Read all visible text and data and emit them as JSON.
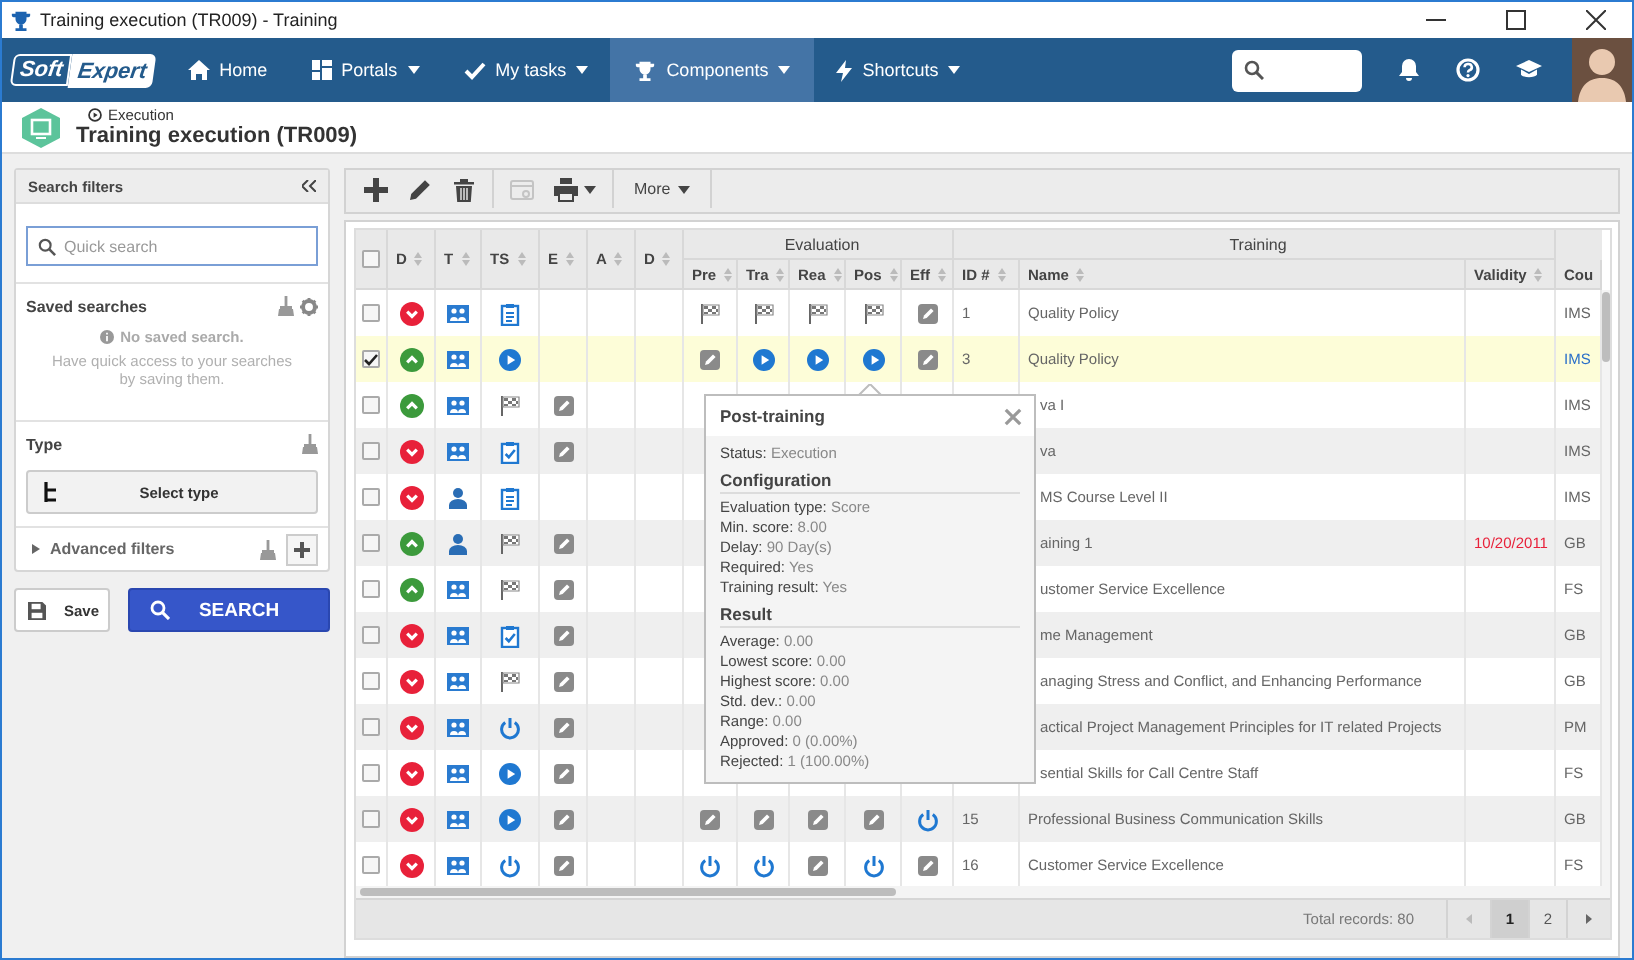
{
  "window": {
    "title": "Training execution (TR009) - Training"
  },
  "nav": {
    "logo_left": "Soft",
    "logo_right": "Expert",
    "items": [
      {
        "label": "Home",
        "dropdown": false,
        "selected": false
      },
      {
        "label": "Portals",
        "dropdown": true,
        "selected": false
      },
      {
        "label": "My tasks",
        "dropdown": true,
        "selected": false
      },
      {
        "label": "Components",
        "dropdown": true,
        "selected": true
      },
      {
        "label": "Shortcuts",
        "dropdown": true,
        "selected": false
      }
    ]
  },
  "page": {
    "breadcrumb": "Execution",
    "title": "Training execution (TR009)"
  },
  "filters": {
    "title": "Search filters",
    "quick_search": {
      "placeholder": "Quick search"
    },
    "saved": {
      "title": "Saved searches",
      "empty": "No saved search.",
      "hint": "Have quick access to your searches by saving them."
    },
    "type": {
      "title": "Type",
      "button": "Select type"
    },
    "advanced": {
      "title": "Advanced filters",
      "expanded": false
    },
    "save_button": "Save",
    "search_button": "SEARCH"
  },
  "toolbar": {
    "buttons": [
      {
        "disabled": false
      },
      {
        "disabled": false
      },
      {
        "disabled": false
      },
      {
        "disabled": true
      },
      {
        "disabled": false
      }
    ],
    "more": "More"
  },
  "grid": {
    "all_checked": false,
    "groups": [
      "Evaluation",
      "Training"
    ],
    "columns": [
      "D",
      "T",
      "TS",
      "E",
      "A",
      "D",
      "Pre",
      "Tra",
      "Rea",
      "Pos",
      "Eff",
      "ID #",
      "Name",
      "Validity",
      "Cou"
    ],
    "rows": [
      {
        "kind": "plain",
        "checked": false,
        "selected": false,
        "cells": [
          {
            "kind": "down"
          },
          {
            "kind": "group"
          },
          {
            "kind": "clipboard"
          },
          {
            "kind": "empty"
          },
          {
            "kind": "empty"
          },
          {
            "kind": "empty"
          },
          {
            "kind": "flag"
          },
          {
            "kind": "flag"
          },
          {
            "kind": "flag"
          },
          {
            "kind": "flag"
          },
          {
            "kind": "edit"
          }
        ],
        "id": "1",
        "name": "Quality Policy",
        "course": "IMS"
      },
      {
        "kind": "plain",
        "checked": true,
        "selected": true,
        "cells": [
          {
            "kind": "up"
          },
          {
            "kind": "group"
          },
          {
            "kind": "play"
          },
          {
            "kind": "empty"
          },
          {
            "kind": "empty"
          },
          {
            "kind": "empty"
          },
          {
            "kind": "edit"
          },
          {
            "kind": "play"
          },
          {
            "kind": "play"
          },
          {
            "kind": "play"
          },
          {
            "kind": "edit"
          }
        ],
        "id": "3",
        "name": "Quality Policy",
        "course": "IMS"
      },
      {
        "kind": "covered",
        "checked": false,
        "selected": false,
        "cells": [
          {
            "kind": "up"
          },
          {
            "kind": "group"
          },
          {
            "kind": "flag"
          },
          {
            "kind": "edit"
          }
        ],
        "name": "va I",
        "course": "IMS"
      },
      {
        "kind": "covered",
        "checked": false,
        "selected": false,
        "cells": [
          {
            "kind": "down"
          },
          {
            "kind": "group"
          },
          {
            "kind": "checklist"
          },
          {
            "kind": "edit"
          }
        ],
        "name": "va",
        "course": "IMS"
      },
      {
        "kind": "covered",
        "checked": false,
        "selected": false,
        "cells": [
          {
            "kind": "down"
          },
          {
            "kind": "person"
          },
          {
            "kind": "clipboard"
          },
          {
            "kind": "empty"
          }
        ],
        "name": "MS Course Level II",
        "course": "IMS"
      },
      {
        "kind": "covered",
        "checked": false,
        "selected": false,
        "cells": [
          {
            "kind": "up"
          },
          {
            "kind": "person"
          },
          {
            "kind": "flag"
          },
          {
            "kind": "edit"
          }
        ],
        "name": "aining 1",
        "validity": {
          "date": "10/20/2011",
          "expired": true
        },
        "course": "GB"
      },
      {
        "kind": "covered",
        "checked": false,
        "selected": false,
        "cells": [
          {
            "kind": "up"
          },
          {
            "kind": "group"
          },
          {
            "kind": "flag"
          },
          {
            "kind": "edit"
          }
        ],
        "name": "ustomer Service Excellence",
        "course": "FS"
      },
      {
        "kind": "covered",
        "checked": false,
        "selected": false,
        "cells": [
          {
            "kind": "down"
          },
          {
            "kind": "group"
          },
          {
            "kind": "checklist"
          },
          {
            "kind": "edit"
          }
        ],
        "name": "me Management",
        "course": "GB"
      },
      {
        "kind": "covered",
        "checked": false,
        "selected": false,
        "cells": [
          {
            "kind": "down"
          },
          {
            "kind": "group"
          },
          {
            "kind": "flag"
          },
          {
            "kind": "edit"
          }
        ],
        "name": "anaging Stress and Conflict, and Enhancing Performance",
        "course": "GB"
      },
      {
        "kind": "covered",
        "checked": false,
        "selected": false,
        "cells": [
          {
            "kind": "down"
          },
          {
            "kind": "group"
          },
          {
            "kind": "power"
          },
          {
            "kind": "edit"
          }
        ],
        "name": "actical Project Management Principles for IT related Projects",
        "course": "PM"
      },
      {
        "kind": "covered",
        "checked": false,
        "selected": false,
        "cells": [
          {
            "kind": "down"
          },
          {
            "kind": "group"
          },
          {
            "kind": "play"
          },
          {
            "kind": "edit"
          }
        ],
        "name": "sential Skills for Call Centre Staff",
        "course": "FS"
      },
      {
        "kind": "plain",
        "checked": false,
        "selected": false,
        "cells": [
          {
            "kind": "down"
          },
          {
            "kind": "group"
          },
          {
            "kind": "play"
          },
          {
            "kind": "edit"
          },
          {
            "kind": "empty"
          },
          {
            "kind": "empty"
          },
          {
            "kind": "edit"
          },
          {
            "kind": "edit"
          },
          {
            "kind": "edit"
          },
          {
            "kind": "edit"
          },
          {
            "kind": "power"
          }
        ],
        "id": "15",
        "name": "Professional Business Communication Skills",
        "course": "GB"
      },
      {
        "kind": "plain",
        "checked": false,
        "selected": false,
        "cells": [
          {
            "kind": "down"
          },
          {
            "kind": "group"
          },
          {
            "kind": "power"
          },
          {
            "kind": "edit"
          },
          {
            "kind": "empty"
          },
          {
            "kind": "empty"
          },
          {
            "kind": "power"
          },
          {
            "kind": "power"
          },
          {
            "kind": "edit"
          },
          {
            "kind": "power"
          },
          {
            "kind": "edit"
          }
        ],
        "id": "16",
        "name": "Customer Service Excellence",
        "course": "FS"
      }
    ],
    "popup": {
      "title": "Post-training",
      "status": "**Status:** Execution",
      "sections": [
        {
          "title": "Configuration",
          "lines": [
            "**Evaluation type:** Score",
            "**Min. score:** 8.00",
            "**Delay:** 90 Day(s)",
            "**Required:** Yes",
            "**Training result:** Yes"
          ]
        },
        {
          "title": "Result",
          "lines": [
            "**Average:** 0.00",
            "**Lowest score:** 0.00",
            "**Highest score:** 0.00",
            "**Std. dev.:** 0.00",
            "**Range:** 0.00",
            "**Approved:** 0 (0.00%)",
            "**Rejected:** 1 (100.00%)"
          ]
        }
      ]
    },
    "footer": {
      "total": "Total records: 80",
      "pages": [
        {
          "label": "1",
          "selected": true
        },
        {
          "label": "2",
          "selected": false
        }
      ]
    }
  }
}
